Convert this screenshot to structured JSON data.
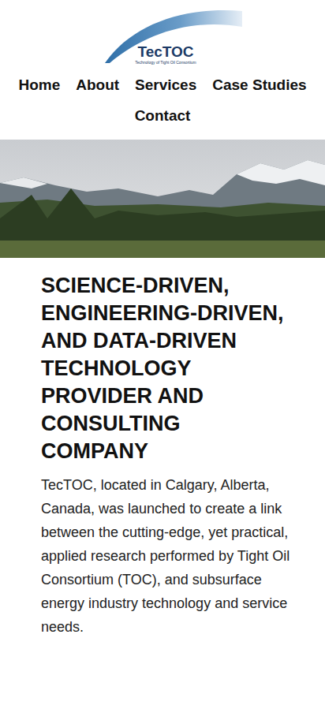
{
  "logo": {
    "name": "TecTOC",
    "tagline": "Technology of Tight Oil Consortium"
  },
  "nav": [
    {
      "label": "Home"
    },
    {
      "label": "About"
    },
    {
      "label": "Services"
    },
    {
      "label": "Case Studies"
    },
    {
      "label": "Contact"
    }
  ],
  "hero": {
    "alt": "mountain landscape photo"
  },
  "content": {
    "heading": "SCIENCE-DRIVEN, ENGINEERING-DRIVEN, AND DATA-DRIVEN TECHNOLOGY PROVIDER AND CONSULTING COMPANY",
    "paragraph": "TecTOC, located in Calgary, Alberta, Canada, was launched to create a link between the cutting-edge, yet practical, applied research performed by Tight Oil Consortium (TOC), and subsurface energy industry technology and service needs."
  }
}
